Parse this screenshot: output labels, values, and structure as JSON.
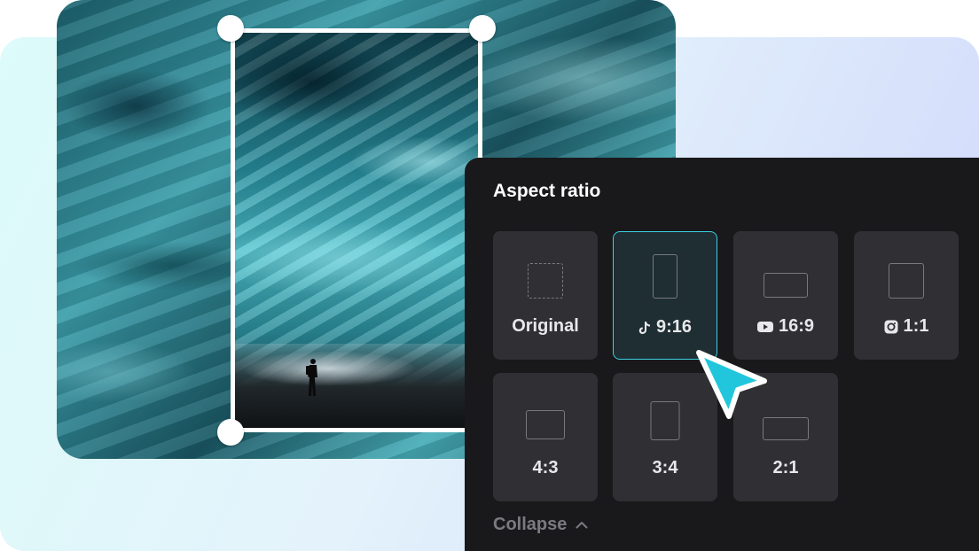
{
  "panel": {
    "title": "Aspect ratio",
    "collapse_label": "Collapse",
    "selected": "9:16",
    "ratios": [
      {
        "label": "Original",
        "icon": "dashed-square-icon"
      },
      {
        "label": "9:16",
        "icon": "tiktok-icon"
      },
      {
        "label": "16:9",
        "icon": "youtube-icon"
      },
      {
        "label": "1:1",
        "icon": "instagram-icon"
      },
      {
        "label": "4:3",
        "icon": ""
      },
      {
        "label": "3:4",
        "icon": ""
      },
      {
        "label": "2:1",
        "icon": ""
      }
    ]
  },
  "colors": {
    "accent": "#3ccfe0",
    "panel_bg": "#19191c",
    "card_bg": "#303034",
    "cursor": "#22c6dc"
  }
}
